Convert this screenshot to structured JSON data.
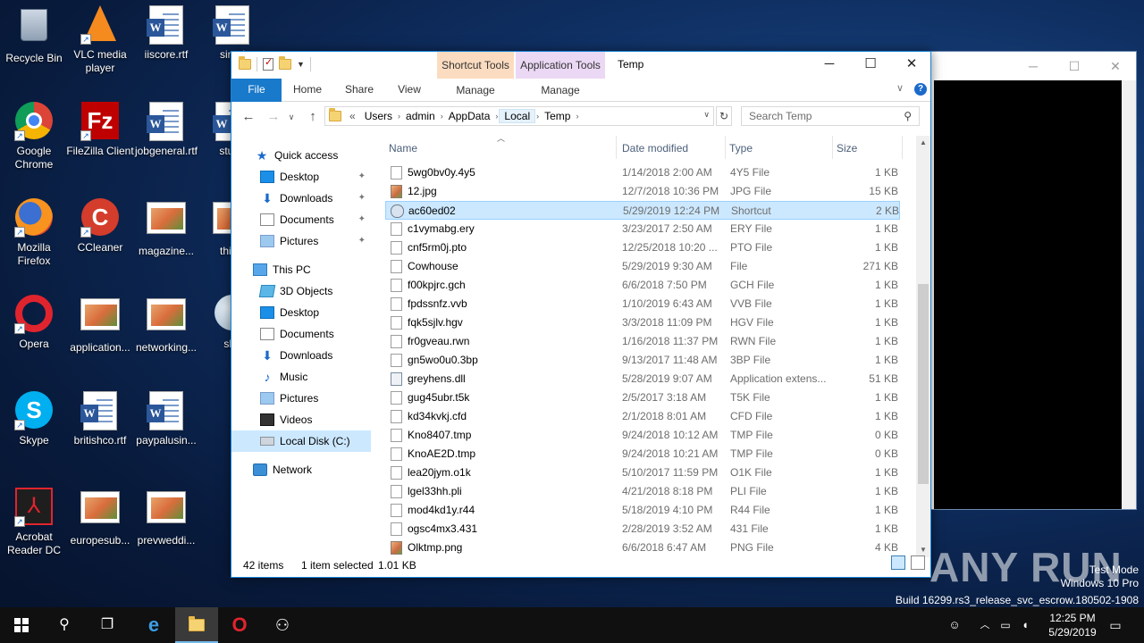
{
  "desktop": {
    "icons": [
      {
        "label": "Recycle Bin",
        "icon": "recycle-bin-icon"
      },
      {
        "label": "VLC media player",
        "icon": "vlc-icon"
      },
      {
        "label": "iiscore.rtf",
        "icon": "word-document-icon"
      },
      {
        "label": "simpl",
        "icon": "word-document-icon"
      },
      {
        "label": "Google Chrome",
        "icon": "chrome-icon"
      },
      {
        "label": "FileZilla Client",
        "icon": "filezilla-icon"
      },
      {
        "label": "jobgeneral.rtf",
        "icon": "word-document-icon"
      },
      {
        "label": "stude",
        "icon": "word-document-icon"
      },
      {
        "label": "Mozilla Firefox",
        "icon": "firefox-icon"
      },
      {
        "label": "CCleaner",
        "icon": "ccleaner-icon"
      },
      {
        "label": "magazine...",
        "icon": "image-file-icon"
      },
      {
        "label": "thinki",
        "icon": "image-file-icon"
      },
      {
        "label": "Opera",
        "icon": "opera-icon"
      },
      {
        "label": "application...",
        "icon": "image-file-icon"
      },
      {
        "label": "networking...",
        "icon": "image-file-icon"
      },
      {
        "label": "sha",
        "icon": "globe-icon"
      },
      {
        "label": "Skype",
        "icon": "skype-icon"
      },
      {
        "label": "britishco.rtf",
        "icon": "word-document-icon"
      },
      {
        "label": "paypalusin...",
        "icon": "word-document-icon"
      },
      {
        "label": "Acrobat Reader DC",
        "icon": "acrobat-icon"
      },
      {
        "label": "europesub...",
        "icon": "image-file-icon"
      },
      {
        "label": "prevweddi...",
        "icon": "image-file-icon"
      }
    ]
  },
  "explorer": {
    "title": "Temp",
    "tool_tabs": {
      "shortcut_tools": "Shortcut Tools",
      "shortcut_manage": "Manage",
      "application_tools": "Application Tools",
      "application_manage": "Manage"
    },
    "ribbon_tabs": [
      "File",
      "Home",
      "Share",
      "View"
    ],
    "address": {
      "prefix": "«",
      "crumbs": [
        "Users",
        "admin",
        "AppData",
        "Local",
        "Temp"
      ]
    },
    "search_placeholder": "Search Temp",
    "nav": {
      "quick_access": "Quick access",
      "quick_items": [
        "Desktop",
        "Downloads",
        "Documents",
        "Pictures"
      ],
      "this_pc": "This PC",
      "pc_items": [
        "3D Objects",
        "Desktop",
        "Documents",
        "Downloads",
        "Music",
        "Pictures",
        "Videos",
        "Local Disk (C:)"
      ],
      "network": "Network"
    },
    "columns": {
      "name": "Name",
      "date": "Date modified",
      "type": "Type",
      "size": "Size"
    },
    "files": [
      {
        "name": "5wg0bv0y.4y5",
        "date": "1/14/2018 2:00 AM",
        "type": "4Y5 File",
        "size": "1 KB",
        "icon": "file"
      },
      {
        "name": "12.jpg",
        "date": "12/7/2018 10:36 PM",
        "type": "JPG File",
        "size": "15 KB",
        "icon": "img"
      },
      {
        "name": "ac60ed02",
        "date": "5/29/2019 12:24 PM",
        "type": "Shortcut",
        "size": "2 KB",
        "icon": "lnk"
      },
      {
        "name": "c1vymabg.ery",
        "date": "3/23/2017 2:50 AM",
        "type": "ERY File",
        "size": "1 KB",
        "icon": "file"
      },
      {
        "name": "cnf5rm0j.pto",
        "date": "12/25/2018 10:20 ...",
        "type": "PTO File",
        "size": "1 KB",
        "icon": "file"
      },
      {
        "name": "Cowhouse",
        "date": "5/29/2019 9:30 AM",
        "type": "File",
        "size": "271 KB",
        "icon": "file"
      },
      {
        "name": "f00kpjrc.gch",
        "date": "6/6/2018 7:50 PM",
        "type": "GCH File",
        "size": "1 KB",
        "icon": "file"
      },
      {
        "name": "fpdssnfz.vvb",
        "date": "1/10/2019 6:43 AM",
        "type": "VVB File",
        "size": "1 KB",
        "icon": "file"
      },
      {
        "name": "fqk5sjlv.hgv",
        "date": "3/3/2018 11:09 PM",
        "type": "HGV File",
        "size": "1 KB",
        "icon": "file"
      },
      {
        "name": "fr0gveau.rwn",
        "date": "1/16/2018 11:37 PM",
        "type": "RWN File",
        "size": "1 KB",
        "icon": "file"
      },
      {
        "name": "gn5wo0u0.3bp",
        "date": "9/13/2017 11:48 AM",
        "type": "3BP File",
        "size": "1 KB",
        "icon": "file"
      },
      {
        "name": "greyhens.dll",
        "date": "5/28/2019 9:07 AM",
        "type": "Application extens...",
        "size": "51 KB",
        "icon": "dll"
      },
      {
        "name": "gug45ubr.t5k",
        "date": "2/5/2017 3:18 AM",
        "type": "T5K File",
        "size": "1 KB",
        "icon": "file"
      },
      {
        "name": "kd34kvkj.cfd",
        "date": "2/1/2018 8:01 AM",
        "type": "CFD File",
        "size": "1 KB",
        "icon": "file"
      },
      {
        "name": "Kno8407.tmp",
        "date": "9/24/2018 10:12 AM",
        "type": "TMP File",
        "size": "0 KB",
        "icon": "file"
      },
      {
        "name": "KnoAE2D.tmp",
        "date": "9/24/2018 10:21 AM",
        "type": "TMP File",
        "size": "0 KB",
        "icon": "file"
      },
      {
        "name": "lea20jym.o1k",
        "date": "5/10/2017 11:59 PM",
        "type": "O1K File",
        "size": "1 KB",
        "icon": "file"
      },
      {
        "name": "lgel33hh.pli",
        "date": "4/21/2018 8:18 PM",
        "type": "PLI File",
        "size": "1 KB",
        "icon": "file"
      },
      {
        "name": "mod4kd1y.r44",
        "date": "5/18/2019 4:10 PM",
        "type": "R44 File",
        "size": "1 KB",
        "icon": "file"
      },
      {
        "name": "ogsc4mx3.431",
        "date": "2/28/2019 3:52 AM",
        "type": "431 File",
        "size": "1 KB",
        "icon": "file"
      },
      {
        "name": "Olktmp.png",
        "date": "6/6/2018 6:47 AM",
        "type": "PNG File",
        "size": "4 KB",
        "icon": "img"
      }
    ],
    "selected_file_index": 2,
    "status": {
      "count": "42 items",
      "selection": "1 item selected",
      "size": "1.01 KB"
    }
  },
  "overlay": {
    "watermark": "ANY RUN",
    "mode": "Test Mode",
    "os": "Windows 10 Pro",
    "build": "Build 16299.rs3_release_svc_escrow.180502-1908"
  },
  "taskbar": {
    "time": "12:25 PM",
    "date": "5/29/2019"
  }
}
